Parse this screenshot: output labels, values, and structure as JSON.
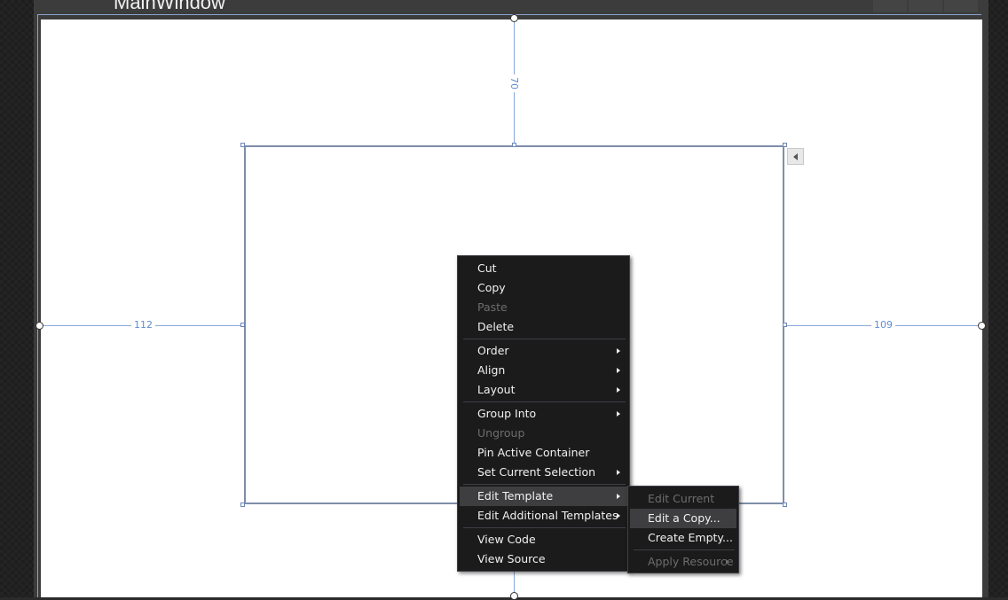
{
  "window": {
    "title": "MainWindow"
  },
  "dimensions": {
    "top": "70",
    "left": "112",
    "right": "109"
  },
  "context_menu": {
    "cut": "Cut",
    "copy": "Copy",
    "paste": "Paste",
    "delete": "Delete",
    "order": "Order",
    "align": "Align",
    "layout": "Layout",
    "group_into": "Group Into",
    "ungroup": "Ungroup",
    "pin_active_container": "Pin Active Container",
    "set_current_selection": "Set Current Selection",
    "edit_template": "Edit Template",
    "edit_additional_templates": "Edit Additional Templates",
    "view_code": "View Code",
    "view_source": "View Source"
  },
  "submenu": {
    "edit_current": "Edit Current",
    "edit_a_copy": "Edit a Copy...",
    "create_empty": "Create Empty...",
    "apply_resource": "Apply Resource"
  },
  "colors": {
    "menu_bg": "#1b1b1b",
    "menu_highlight": "#3e3e40",
    "guide": "#8aa8d8",
    "dimension_text": "#5e8dd0"
  }
}
